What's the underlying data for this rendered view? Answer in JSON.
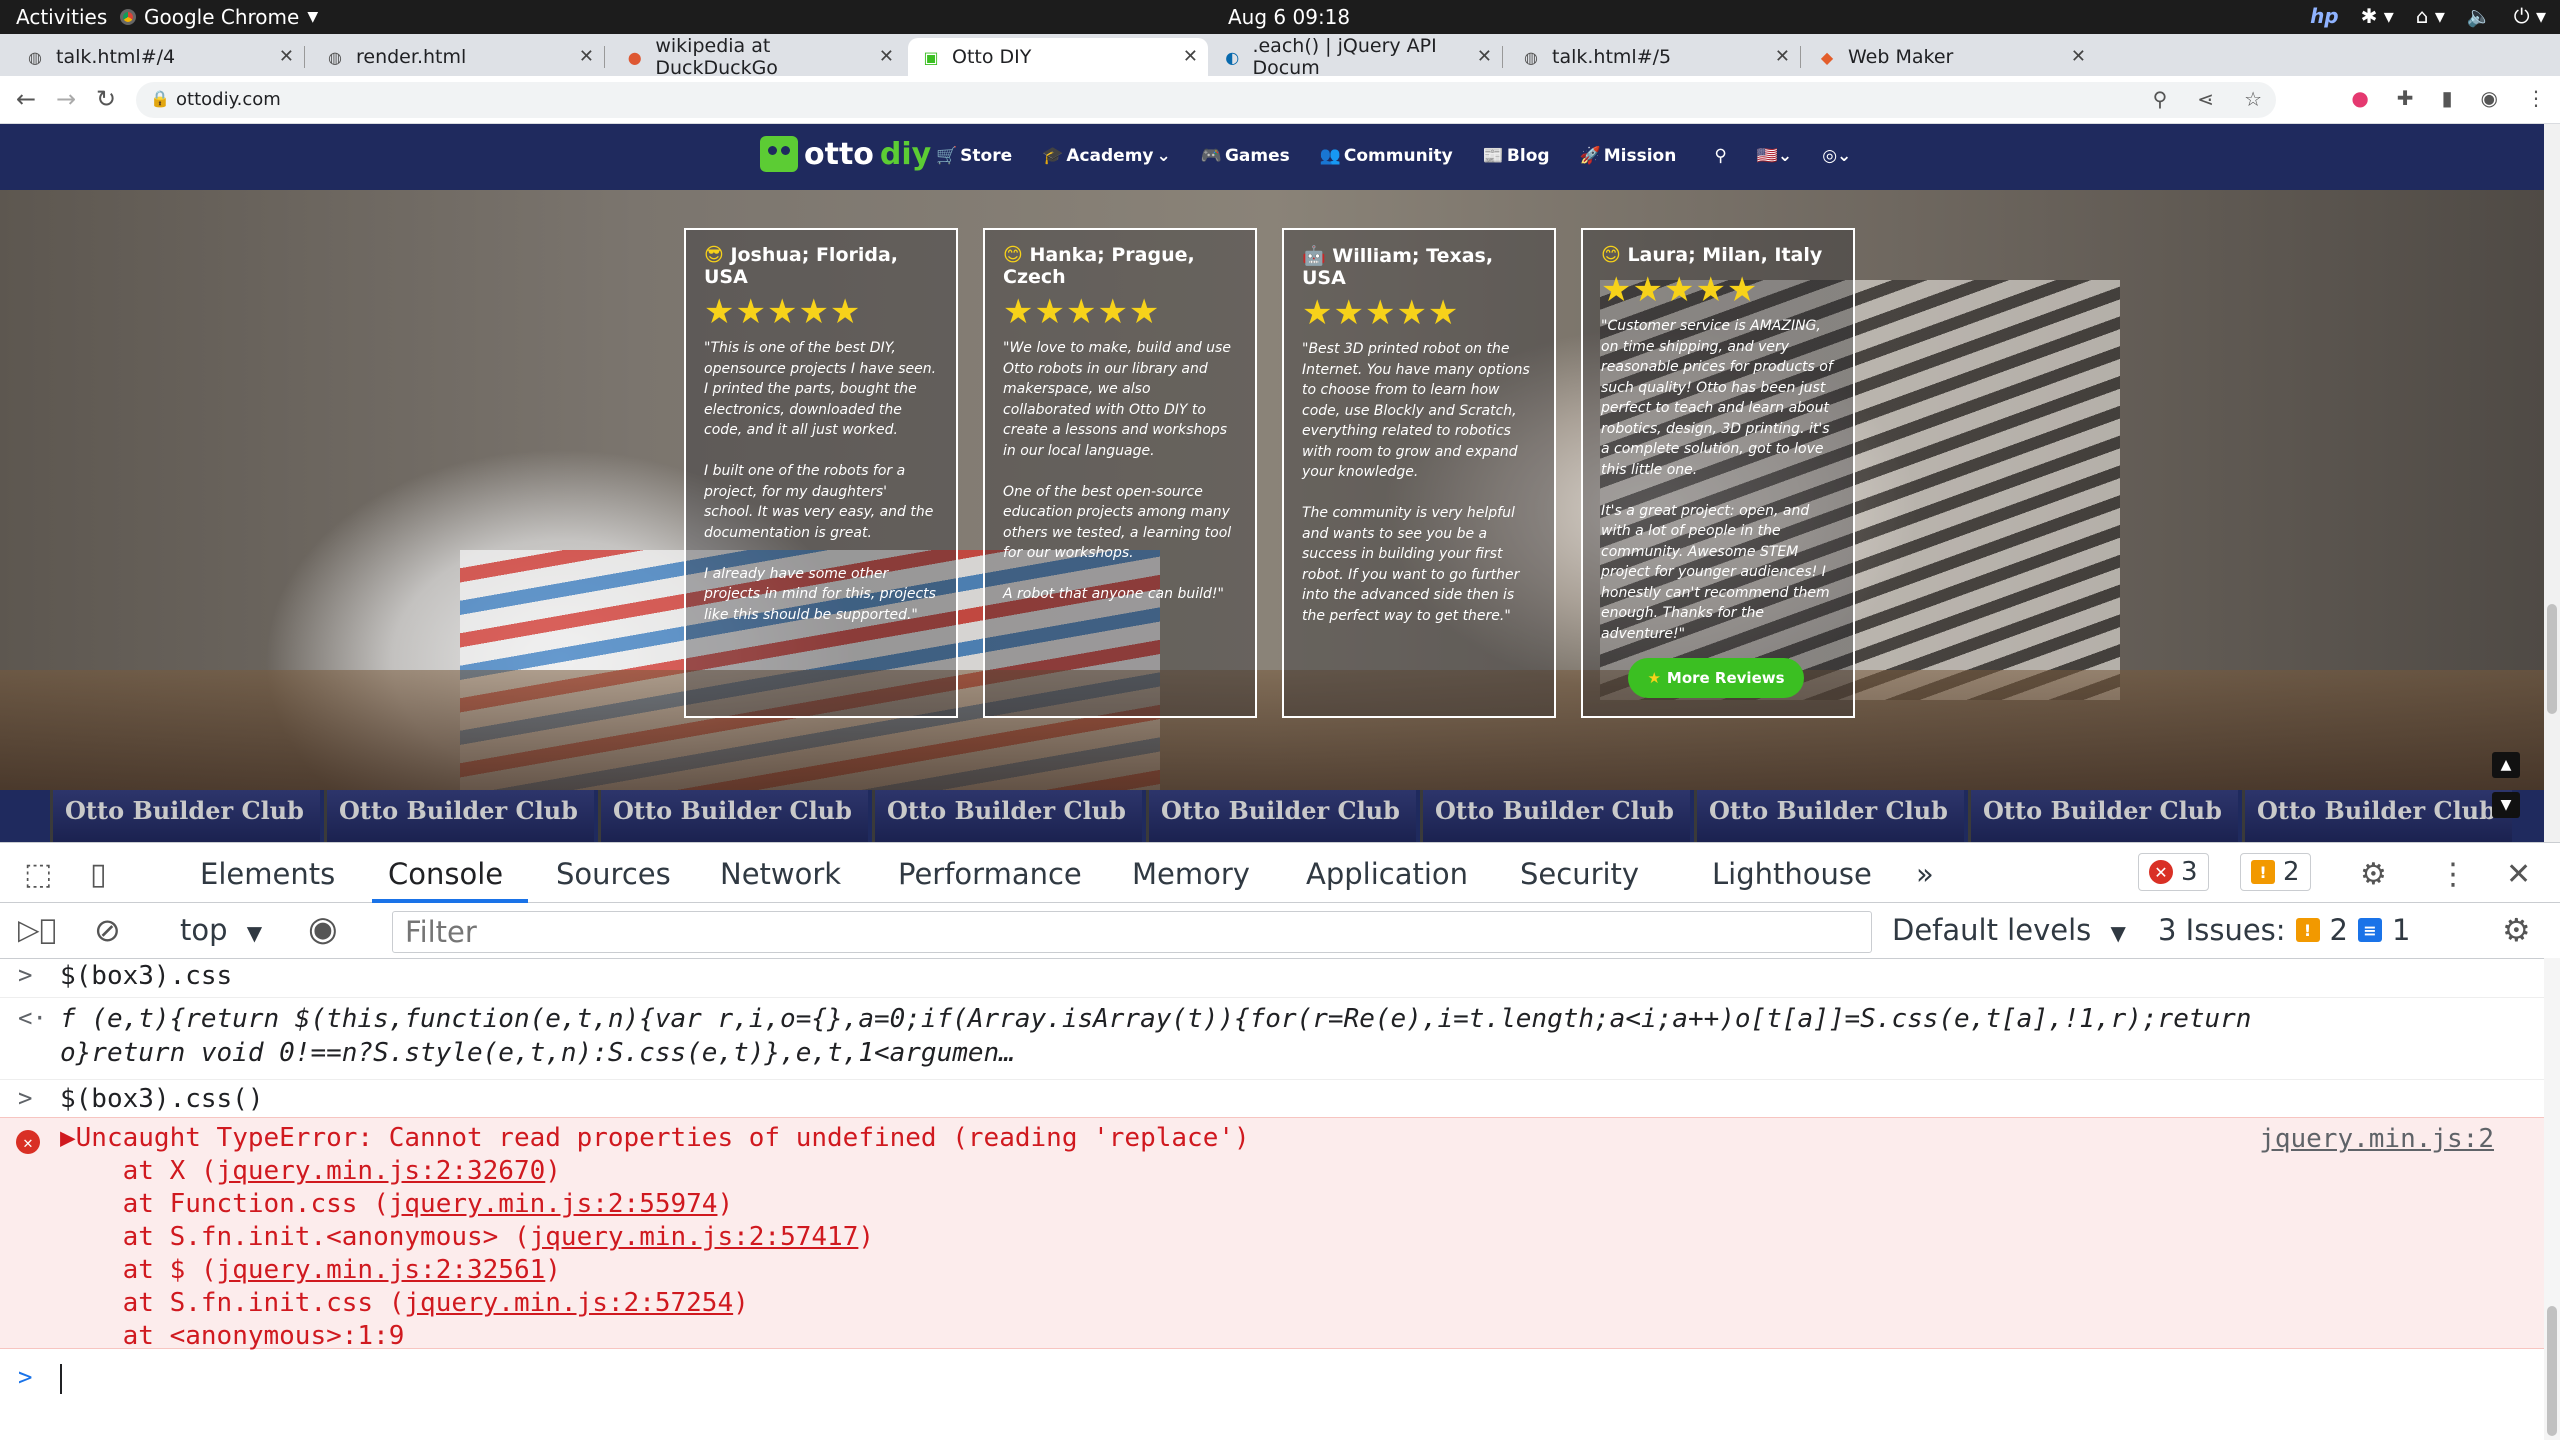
{
  "gnome": {
    "activities": "Activities",
    "app": "Google Chrome",
    "clock": "Aug 6  09:18"
  },
  "tabs": [
    {
      "title": "talk.html#/4",
      "icon": "globe-icon"
    },
    {
      "title": "render.html",
      "icon": "globe-icon"
    },
    {
      "title": "wikipedia at DuckDuckGo",
      "icon": "duckduckgo-icon"
    },
    {
      "title": "Otto DIY",
      "icon": "otto-icon"
    },
    {
      "title": ".each() | jQuery API Docum",
      "icon": "jquery-icon"
    },
    {
      "title": "talk.html#/5",
      "icon": "globe-icon"
    },
    {
      "title": "Web Maker",
      "icon": "webmaker-icon"
    }
  ],
  "address": {
    "url": "ottodiy.com"
  },
  "site": {
    "logo_otto": "otto",
    "logo_diy": "diy",
    "nav": [
      "Store",
      "Academy",
      "Games",
      "Community",
      "Blog",
      "Mission"
    ],
    "reviews": [
      {
        "name": "Joshua; Florida, USA",
        "text": "\"This is one of the best DIY, opensource projects I have seen. I printed the parts, bought the electronics, downloaded the code, and it all just worked.\n\nI built one of the robots for a project, for my daughters' school. It was very easy, and the documentation is great.\n\nI already have some other projects in mind for this, projects like this should be supported.\""
      },
      {
        "name": "Hanka; Prague, Czech",
        "text": "\"We love to make, build and use Otto robots in our library and makerspace, we also collaborated with Otto DIY to create a lessons and workshops in our local language.\n\nOne of the best open-source education projects among many others we tested, a learning tool for our workshops.\n\nA robot that anyone can build!\""
      },
      {
        "name": "William; Texas, USA",
        "text": "\"Best 3D printed robot on the Internet. You have many options to choose from to learn how code, use Blockly and Scratch, everything related to robotics with room to grow and expand your knowledge.\n\nThe community is very helpful and wants to see you be a success in building your first robot. If you want to go further into the advanced side then is the perfect way to get there.\""
      },
      {
        "name": "Laura; Milan, Italy",
        "text": "\"Customer service is AMAZING, on time shipping, and very reasonable prices for products of such quality! Otto has been just perfect to teach and learn about robotics, design, 3D printing. it's a complete solution, got to love this little one.\n\nIt's a great project: open, and with a lot of people in the community. Awesome STEM project for younger audiences! I honestly can't recommend them enough. Thanks for the adventure!\""
      }
    ],
    "stars": "★★★★★",
    "more_reviews": "More Reviews",
    "club_label": "Otto Builder Club"
  },
  "devtools": {
    "tabs": [
      "Elements",
      "Console",
      "Sources",
      "Network",
      "Performance",
      "Memory",
      "Application",
      "Security",
      "Lighthouse"
    ],
    "more": "»",
    "error_count": "3",
    "warning_count": "2",
    "context": "top",
    "filter_placeholder": "Filter",
    "levels": "Default levels",
    "issues_label": "3 Issues:",
    "issues_warn": "2",
    "issues_info": "1"
  },
  "console": {
    "input1": "$(box3).css",
    "result1_line1": "f (e,t){return $(this,function(e,t,n){var r,i,o={},a=0;if(Array.isArray(t)){for(r=Re(e),i=t.length;a<i;a++)o[t[a]]=S.css(e,t[a],!1,r);return",
    "result1_line2": "o}return void 0!==n?S.style(e,t,n):S.css(e,t)},e,t,1<argumen…",
    "input2": "$(box3).css()",
    "error_msg": "Uncaught TypeError: Cannot read properties of undefined (reading 'replace')",
    "error_src": "jquery.min.js:2",
    "stack": [
      {
        "prefix": "at X (",
        "link": "jquery.min.js:2:32670",
        "suffix": ")"
      },
      {
        "prefix": "at Function.css (",
        "link": "jquery.min.js:2:55974",
        "suffix": ")"
      },
      {
        "prefix": "at S.fn.init.<anonymous> (",
        "link": "jquery.min.js:2:57417",
        "suffix": ")"
      },
      {
        "prefix": "at $ (",
        "link": "jquery.min.js:2:32561",
        "suffix": ")"
      },
      {
        "prefix": "at S.fn.init.css (",
        "link": "jquery.min.js:2:57254",
        "suffix": ")"
      },
      {
        "prefix": "at <anonymous>:1:9",
        "link": "",
        "suffix": ""
      }
    ]
  }
}
